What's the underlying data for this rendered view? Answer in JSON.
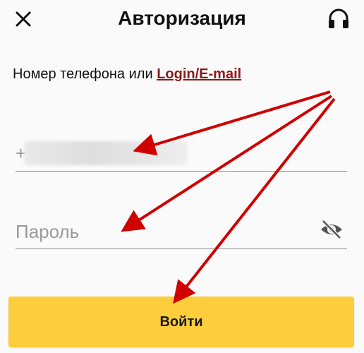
{
  "header": {
    "title": "Авторизация",
    "close_icon": "close-icon",
    "support_icon": "headset-icon"
  },
  "form": {
    "phone_label_prefix": "Номер телефона или ",
    "phone_label_link": "Login/E-mail",
    "phone_prefix": "+",
    "password_placeholder": "Пароль",
    "eye_icon": "eye-off-icon",
    "submit_label": "Войти"
  },
  "colors": {
    "accent": "#fdcd3e",
    "link": "#8b1b1b",
    "arrow": "#d00000",
    "underline": "#8a8a8a"
  }
}
